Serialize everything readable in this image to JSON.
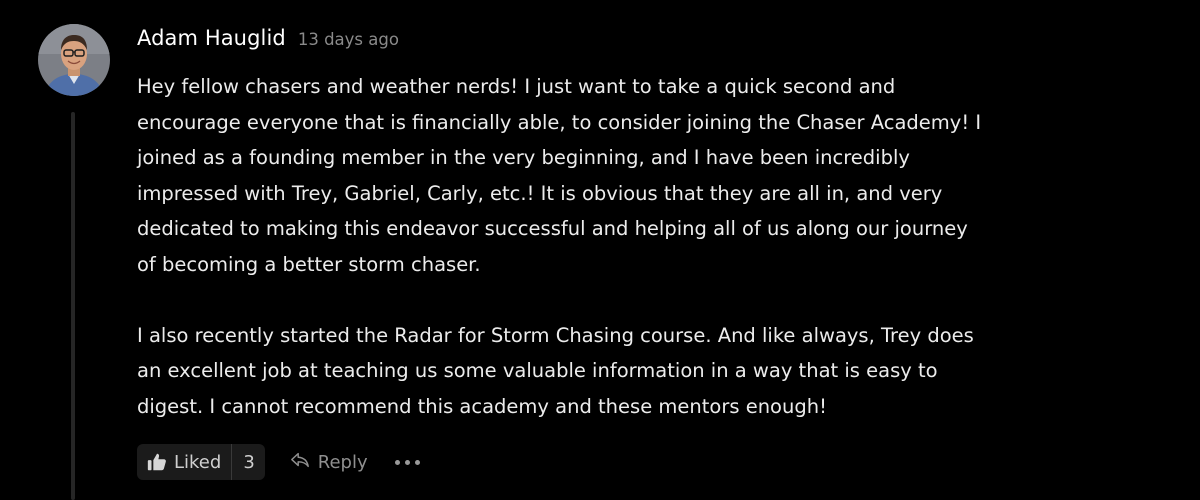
{
  "comment": {
    "author": "Adam Hauglid",
    "timestamp": "13 days ago",
    "paragraph1": [
      "Hey fellow chasers and weather nerds! I just want to take a quick second and",
      "encourage everyone that is financially able, to consider joining the Chaser Academy! I",
      "joined as a founding member in the very beginning, and I have been incredibly",
      "impressed with Trey, Gabriel, Carly, etc.! It is obvious that they are all in, and very",
      "dedicated to making this endeavor successful and helping all of us along our journey",
      "of becoming a better storm chaser."
    ],
    "paragraph2": [
      "I also recently started the Radar for Storm Chasing course. And like always, Trey does",
      "an excellent job at teaching us some valuable information in a way that is easy to",
      "digest. I cannot recommend this academy and these mentors enough!"
    ]
  },
  "actions": {
    "like_label": "Liked",
    "like_count": "3",
    "reply_label": "Reply"
  },
  "colors": {
    "background": "#000000",
    "text": "#ececec",
    "muted": "#8a8a8a",
    "button_bg": "#1b1b1b"
  }
}
